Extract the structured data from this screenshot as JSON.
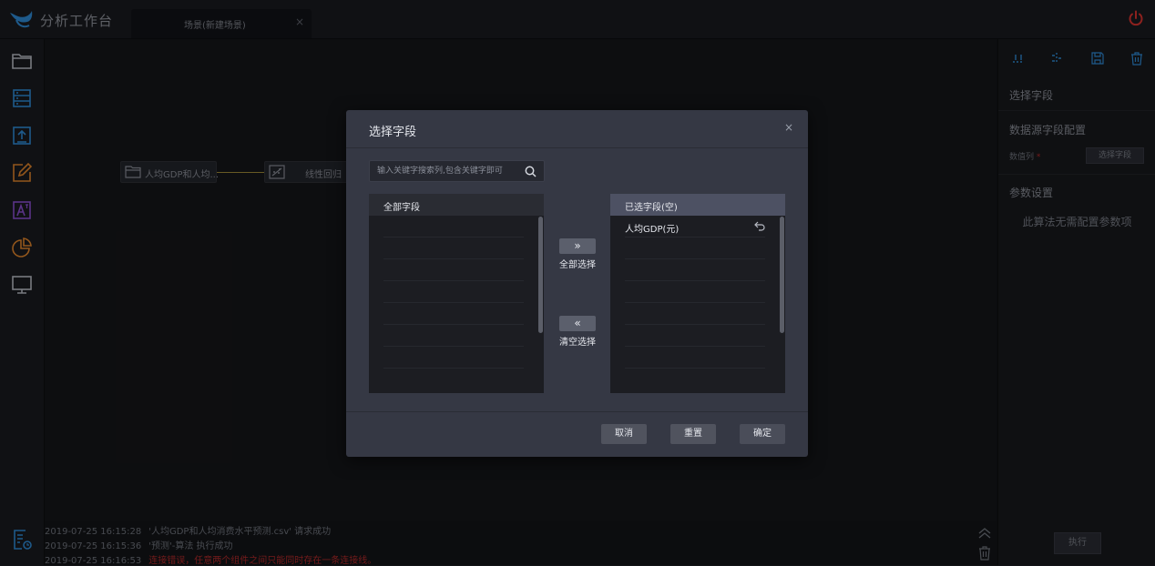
{
  "header": {
    "app_title": "分析工作台",
    "tab_label": "场景(新建场景)",
    "tab_close": "×"
  },
  "left_rail": {
    "icons": [
      "folder-icon",
      "database-list-icon",
      "upload-icon",
      "edit-icon",
      "text-style-icon",
      "pie-chart-icon",
      "monitor-icon",
      "report-settings-icon"
    ]
  },
  "canvas": {
    "nodes": [
      {
        "label": "人均GDP和人均...",
        "icon": "folder-icon"
      },
      {
        "label": "线性回归",
        "icon": "regression-icon"
      }
    ]
  },
  "log": {
    "lines": [
      {
        "time": "2019-07-25 16:15:28",
        "msg": "'人均GDP和人均消费水平预测.csv' 请求成功",
        "error": false
      },
      {
        "time": "2019-07-25 16:15:36",
        "msg": "'预测'-算法 执行成功",
        "error": false
      },
      {
        "time": "2019-07-25 16:16:53",
        "msg": "连接错误，任意两个组件之间只能同时存在一条连接线。",
        "error": true
      }
    ]
  },
  "right_panel": {
    "title": "选择字段",
    "section_datasource": "数据源字段配置",
    "numeric_col_label": "数值列",
    "required_mark": "*",
    "select_field_button": "选择字段",
    "section_params": "参数设置",
    "params_note": "此算法无需配置参数项",
    "execute_button": "执行",
    "tools": [
      "align-top-icon",
      "align-vertical-icon",
      "save-icon",
      "trash-icon"
    ]
  },
  "modal": {
    "title": "选择字段",
    "close": "×",
    "search_placeholder": "输入关键字搜索列,包含关键字即可",
    "left_list": {
      "header": "全部字段",
      "items": []
    },
    "right_list": {
      "header": "已选字段(空)",
      "items": [
        "人均GDP(元)"
      ]
    },
    "select_all_arrows": "»",
    "select_all_label": "全部选择",
    "clear_arrows": "«",
    "clear_label": "清空选择",
    "cancel": "取消",
    "reset": "重置",
    "confirm": "确定"
  },
  "colors": {
    "accent_blue": "#2f8bd6",
    "accent_orange": "#e0852b",
    "accent_purple": "#8a4fd0",
    "error_red": "#b32a2a",
    "power_red": "#d9332f",
    "link_gold": "#a08a38"
  }
}
